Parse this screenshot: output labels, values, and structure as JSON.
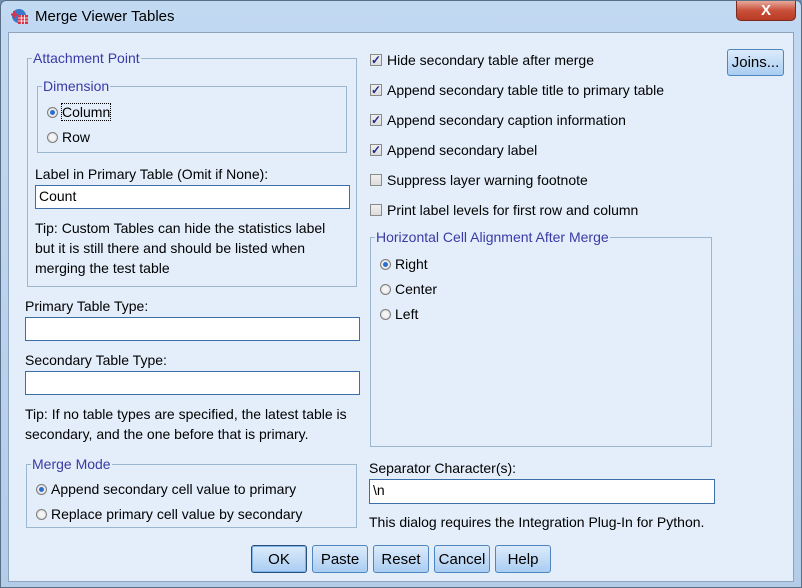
{
  "window": {
    "title": "Merge Viewer Tables",
    "close_label": "X"
  },
  "attachment_point": {
    "legend": "Attachment Point",
    "dimension": {
      "legend": "Dimension",
      "options": [
        {
          "label": "Column",
          "selected": true
        },
        {
          "label": "Row",
          "selected": false
        }
      ]
    },
    "label_field": {
      "label": "Label in Primary Table (Omit if None):",
      "value": "Count"
    },
    "tip": [
      "Tip: Custom Tables can hide the statistics label",
      "but it is still there and should be listed when",
      "merging the test table"
    ]
  },
  "primary_table_type": {
    "label": "Primary Table Type:",
    "value": ""
  },
  "secondary_table_type": {
    "label": "Secondary Table Type:",
    "value": ""
  },
  "types_tip": [
    "Tip: If no table types are specified, the latest table is",
    "secondary, and the one before that is primary."
  ],
  "merge_mode": {
    "legend": "Merge Mode",
    "options": [
      {
        "label": "Append secondary cell value to primary",
        "selected": true
      },
      {
        "label": "Replace primary cell value by secondary",
        "selected": false
      }
    ]
  },
  "checkboxes": [
    {
      "label": "Hide secondary table after merge",
      "checked": true
    },
    {
      "label": "Append secondary table title to primary table",
      "checked": true
    },
    {
      "label": "Append secondary caption information",
      "checked": true
    },
    {
      "label": "Append secondary label",
      "checked": true
    },
    {
      "label": "Suppress layer warning footnote",
      "checked": false
    },
    {
      "label": "Print label levels for first row and column",
      "checked": false
    }
  ],
  "alignment": {
    "legend": "Horizontal Cell Alignment After Merge",
    "options": [
      {
        "label": "Right",
        "selected": true
      },
      {
        "label": "Center",
        "selected": false
      },
      {
        "label": "Left",
        "selected": false
      }
    ]
  },
  "separator": {
    "label": "Separator Character(s):",
    "value": "\\n"
  },
  "plugin_note": "This dialog requires the Integration Plug-In for Python.",
  "buttons": {
    "joins": "Joins...",
    "ok": "OK",
    "paste": "Paste",
    "reset": "Reset",
    "cancel": "Cancel",
    "help": "Help"
  }
}
